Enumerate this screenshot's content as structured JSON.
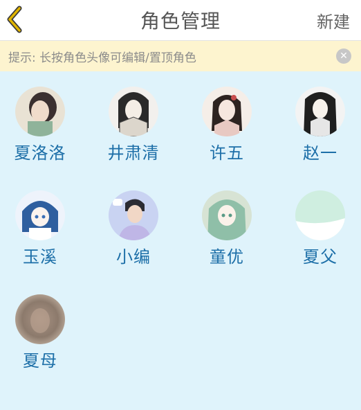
{
  "header": {
    "title": "角色管理",
    "new_label": "新建",
    "back_icon": "chevron-left-icon",
    "accent": "#e0b400"
  },
  "tip": {
    "text": "提示: 长按角色头像可编辑/置顶角色",
    "close_icon": "close-circle-icon"
  },
  "characters": [
    {
      "name": "夏洛洛",
      "avatar_bg": "#e9e2d4",
      "avatar_fg": "#3b3030"
    },
    {
      "name": "井肃清",
      "avatar_bg": "#f2f0ed",
      "avatar_fg": "#2a2a2a"
    },
    {
      "name": "许五",
      "avatar_bg": "#f5eee8",
      "avatar_fg": "#2d2320"
    },
    {
      "name": "赵一",
      "avatar_bg": "#f3f3f3",
      "avatar_fg": "#1f1f1f"
    },
    {
      "name": "玉溪",
      "avatar_bg": "#eef3fb",
      "avatar_fg": "#2f5f9f"
    },
    {
      "name": "小编",
      "avatar_bg": "#c9d3f2",
      "avatar_fg": "#2b2b33"
    },
    {
      "name": "童优",
      "avatar_bg": "#d7e3d4",
      "avatar_fg": "#7fb0a0"
    },
    {
      "name": "夏父",
      "avatar_bg": "#cfeee0",
      "avatar_fg": "#ffffff"
    },
    {
      "name": "夏母",
      "avatar_bg": "#b7a596",
      "avatar_fg": "#8a7566"
    }
  ]
}
